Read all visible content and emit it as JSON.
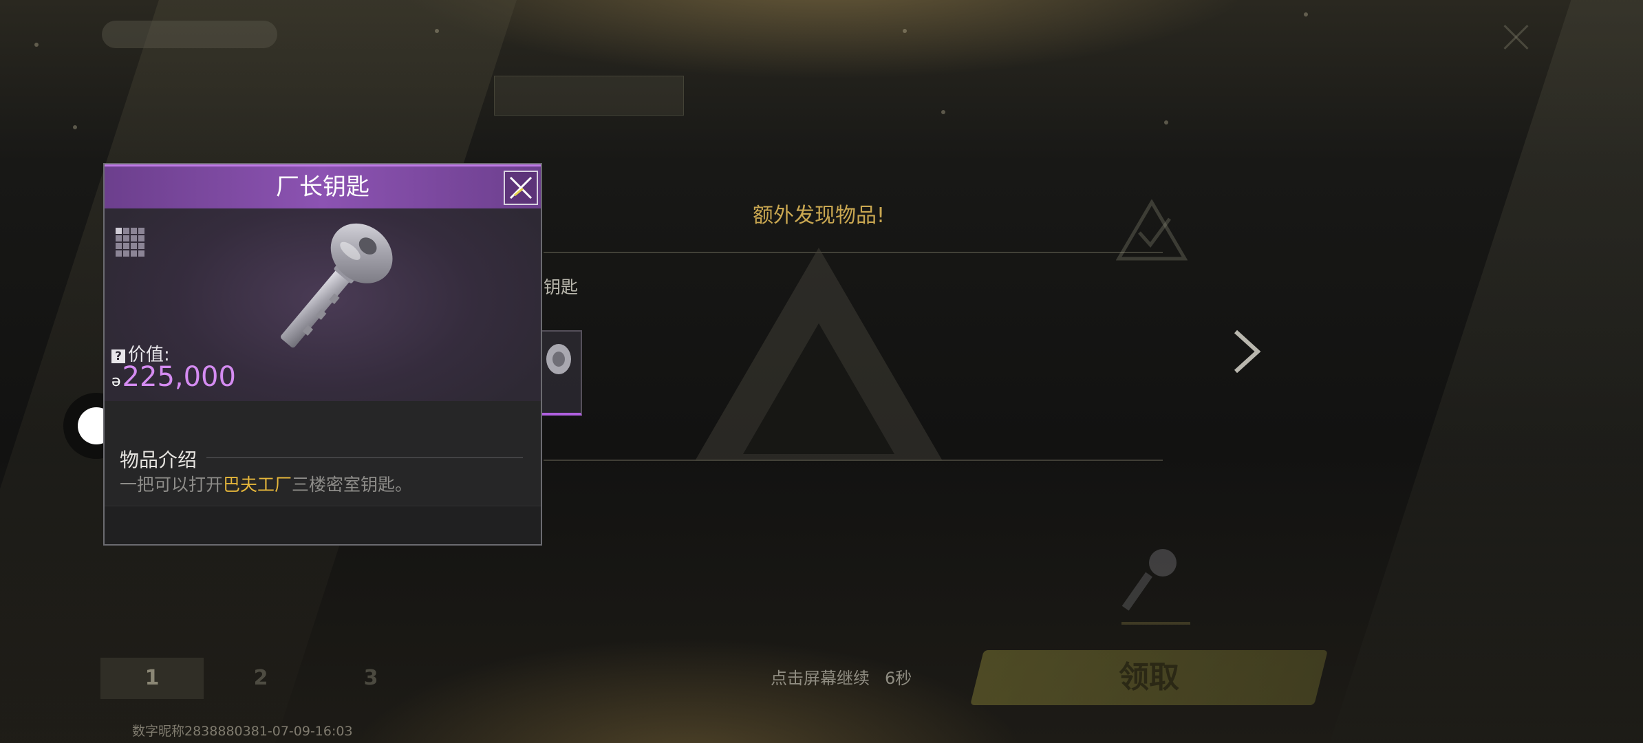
{
  "background": {
    "banner_title": "额外发现物品!",
    "item_name_partial": "钥匙",
    "continue_hint": "点击屏幕继续",
    "countdown": "6秒",
    "claim_label": "领取",
    "tabs": [
      "1",
      "2",
      "3"
    ],
    "watermark": "数字昵称2838880381-07-09-16:03"
  },
  "popup": {
    "title": "厂长钥匙",
    "value_label": "价值:",
    "value_amount": "225,000",
    "section_title": "物品介绍",
    "description": {
      "before": "一把可以打开",
      "highlight": "巴夫工厂",
      "after": "三楼密室钥匙。"
    }
  },
  "colors": {
    "rarity_purple": "#8c53b2",
    "value_purple": "#d58cf2",
    "highlight_gold": "#e6b73b",
    "banner_gold": "#c9a751"
  },
  "icons": [
    "close-icon",
    "grid-size-icon",
    "key-icon",
    "question-icon",
    "coin-icon",
    "chevron-right-icon"
  ]
}
